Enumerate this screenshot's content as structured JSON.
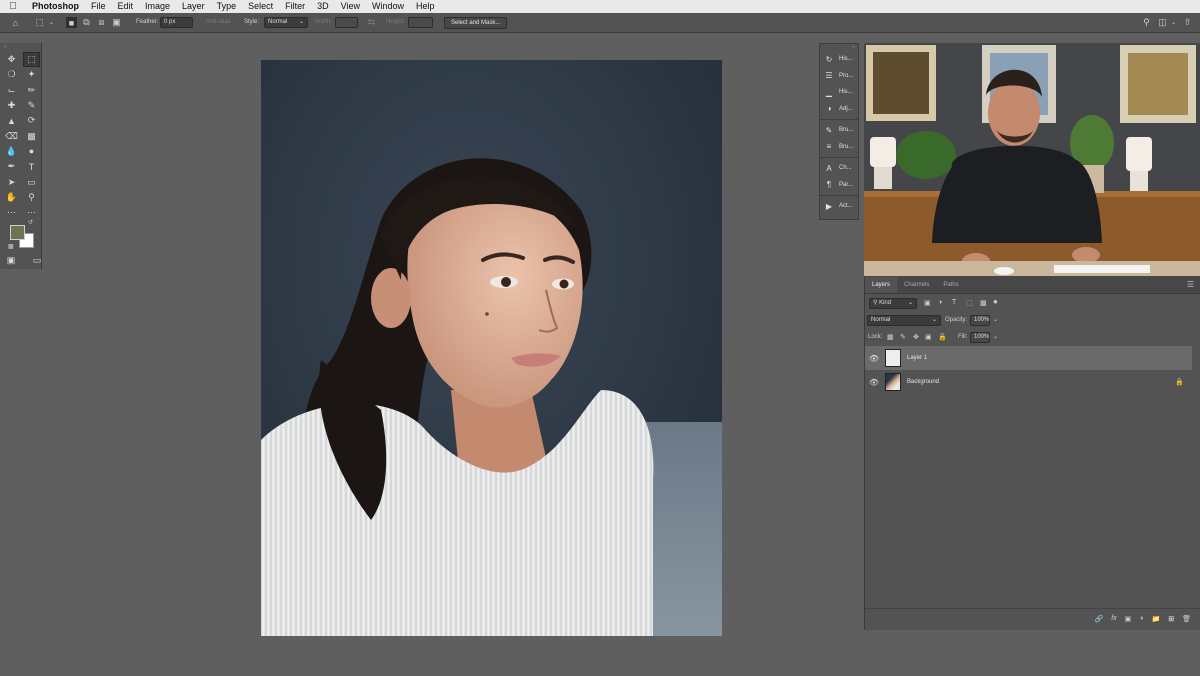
{
  "menubar": {
    "app_name": "Photoshop",
    "items": [
      "File",
      "Edit",
      "Image",
      "Layer",
      "Type",
      "Select",
      "Filter",
      "3D",
      "View",
      "Window",
      "Help"
    ]
  },
  "options_bar": {
    "feather_label": "Feather:",
    "feather_value": "0 px",
    "anti_alias_label": "Anti-alias",
    "style_label": "Style:",
    "style_value": "Normal",
    "width_label": "Width:",
    "height_label": "Height:",
    "select_mask_label": "Select and Mask..."
  },
  "panel_strip": {
    "items": [
      {
        "icon": "history-icon",
        "label": "His..."
      },
      {
        "icon": "properties-icon",
        "label": "Pro..."
      },
      {
        "icon": "histogram-icon",
        "label": "His..."
      },
      {
        "icon": "adjustments-icon",
        "label": "Adj..."
      },
      {
        "icon": "brush-icon",
        "label": "Bru..."
      },
      {
        "icon": "brush-settings-icon",
        "label": "Bru..."
      },
      {
        "icon": "character-icon",
        "label": "Ch..."
      },
      {
        "icon": "paragraph-icon",
        "label": "Par..."
      },
      {
        "icon": "actions-icon",
        "label": "Act..."
      }
    ]
  },
  "layers_panel": {
    "tabs": [
      "Layers",
      "Channels",
      "Paths"
    ],
    "active_tab": "Layers",
    "kind_filter": "Kind",
    "blend_mode": "Normal",
    "opacity_label": "Opacity:",
    "opacity_value": "100%",
    "lock_label": "Lock:",
    "fill_label": "Fill:",
    "fill_value": "100%",
    "layers": [
      {
        "name": "Layer 1",
        "visible": true,
        "selected": true,
        "locked": false
      },
      {
        "name": "Background",
        "visible": true,
        "selected": false,
        "locked": true
      }
    ]
  },
  "colors": {
    "foreground": "#6f7353",
    "background": "#ffffff",
    "workspace": "#5f5f5f",
    "panel": "#535353"
  }
}
